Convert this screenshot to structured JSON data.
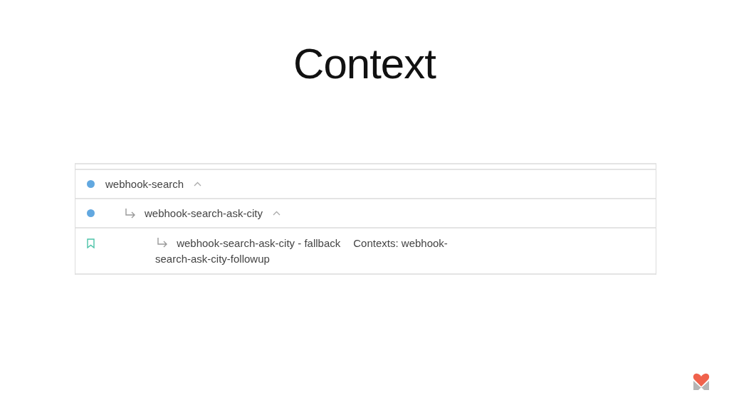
{
  "title": "Context",
  "intents": [
    {
      "name": "webhook-search",
      "kind": "intent",
      "expanded": true,
      "children": [
        {
          "name": "webhook-search-ask-city",
          "kind": "intent",
          "expanded": true,
          "children": [
            {
              "name": "webhook-search-ask-city - fallback",
              "kind": "fallback",
              "contexts": "Contexts: webhook-search-ask-city-followup"
            }
          ]
        }
      ]
    }
  ]
}
